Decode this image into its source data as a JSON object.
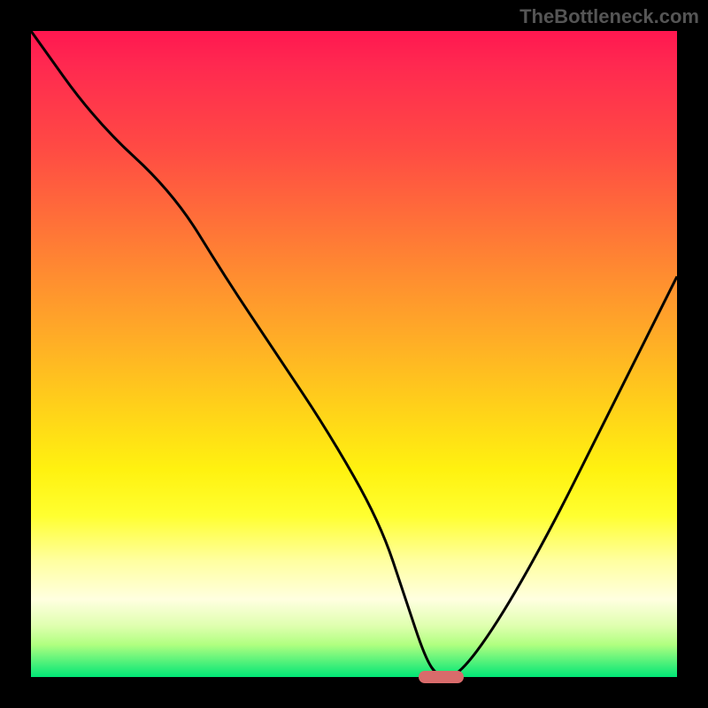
{
  "watermark": "TheBottleneck.com",
  "chart_data": {
    "type": "line",
    "title": "",
    "xlabel": "",
    "ylabel": "",
    "xlim": [
      0,
      100
    ],
    "ylim": [
      0,
      100
    ],
    "description": "Bottleneck curve showing mismatch percentage (y, 0=green optimal at bottom, 100=red severe at top) versus component balance parameter (x). Curve drops from top-left to a minimum near x≈63 then rises toward top-right. Background gradient encodes severity: green (bottom) → yellow → orange → red (top).",
    "series": [
      {
        "name": "bottleneck_pct",
        "x": [
          0,
          10,
          22,
          30,
          38,
          46,
          54,
          58,
          61,
          63,
          66,
          72,
          80,
          88,
          94,
          100
        ],
        "values": [
          100,
          86,
          75,
          62,
          50,
          38,
          24,
          12,
          3,
          0,
          0,
          8,
          22,
          38,
          50,
          62
        ]
      }
    ],
    "optimal_marker": {
      "x_center": 63.5,
      "y": 0,
      "width_pct": 7
    },
    "gradient_stops": [
      {
        "pct": 0,
        "color": "#ff1750"
      },
      {
        "pct": 50,
        "color": "#ffd01a"
      },
      {
        "pct": 88,
        "color": "#ffffe0"
      },
      {
        "pct": 100,
        "color": "#00e676"
      }
    ]
  }
}
